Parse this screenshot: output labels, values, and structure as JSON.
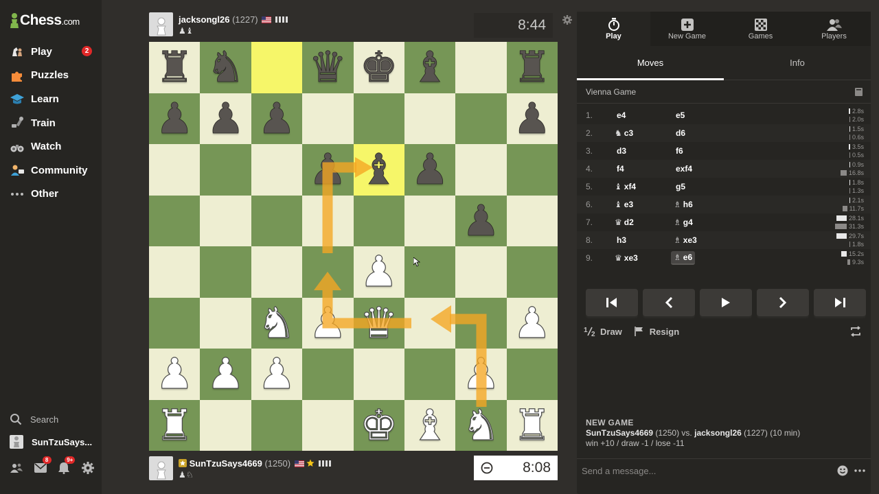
{
  "sidebar": {
    "logo_main": "Chess",
    "logo_suffix": ".com",
    "items": [
      {
        "label": "Play",
        "icon": "play-pieces-icon",
        "badge": "2"
      },
      {
        "label": "Puzzles",
        "icon": "puzzle-icon"
      },
      {
        "label": "Learn",
        "icon": "graduation-cap-icon"
      },
      {
        "label": "Train",
        "icon": "train-icon"
      },
      {
        "label": "Watch",
        "icon": "binoculars-icon"
      },
      {
        "label": "Community",
        "icon": "community-icon"
      },
      {
        "label": "Other",
        "icon": "more-dots-icon"
      }
    ],
    "search_label": "Search",
    "username": "SunTzuSays...",
    "badges": {
      "messages": "8",
      "notifications": "9+"
    }
  },
  "top_player": {
    "name": "jacksongl26",
    "rating": "(1227)",
    "captured": "♟♝",
    "clock": "8:44"
  },
  "bottom_player": {
    "name": "SunTzuSays4669",
    "rating": "(1250)",
    "captured": "♟♘",
    "clock": "8:08"
  },
  "board": [
    [
      "r",
      "n",
      "",
      "q",
      "k",
      "b",
      "",
      "r"
    ],
    [
      "p",
      "p",
      "p",
      "",
      "",
      "",
      "",
      "p"
    ],
    [
      "",
      "",
      "",
      "p",
      "b",
      "p",
      "",
      ""
    ],
    [
      "",
      "",
      "",
      "",
      "",
      "",
      "p",
      ""
    ],
    [
      "",
      "",
      "",
      "",
      "P",
      "",
      "",
      ""
    ],
    [
      "",
      "",
      "N",
      "P",
      "Q",
      "",
      "",
      "P"
    ],
    [
      "P",
      "P",
      "P",
      "",
      "",
      "",
      "P",
      ""
    ],
    [
      "R",
      "",
      "",
      "",
      "K",
      "B",
      "N",
      "R"
    ]
  ],
  "highlights": [
    [
      0,
      2
    ],
    [
      2,
      4
    ]
  ],
  "panel": {
    "tabs": [
      {
        "label": "Play",
        "icon": "timer-icon"
      },
      {
        "label": "New Game",
        "icon": "plus-icon"
      },
      {
        "label": "Games",
        "icon": "board-icon"
      },
      {
        "label": "Players",
        "icon": "players-icon"
      }
    ],
    "subtabs": [
      "Moves",
      "Info"
    ],
    "opening": "Vienna Game",
    "moves": [
      {
        "n": "1.",
        "w": "e4",
        "wf": "",
        "b": "e5",
        "bf": "",
        "wt": "2.8s",
        "bt": "2.0s",
        "wbar": 2,
        "bbar": 1
      },
      {
        "n": "2.",
        "w": "c3",
        "wf": "♞",
        "b": "d6",
        "bf": "",
        "wt": "1.5s",
        "bt": "0.6s",
        "wbar": 1,
        "bbar": 1
      },
      {
        "n": "3.",
        "w": "d3",
        "wf": "",
        "b": "f6",
        "bf": "",
        "wt": "3.5s",
        "bt": "0.5s",
        "wbar": 2,
        "bbar": 1
      },
      {
        "n": "4.",
        "w": "f4",
        "wf": "",
        "b": "exf4",
        "bf": "",
        "wt": "0.9s",
        "bt": "16.8s",
        "wbar": 1,
        "bbar": 8
      },
      {
        "n": "5.",
        "w": "xf4",
        "wf": "♝",
        "b": "g5",
        "bf": "",
        "wt": "1.8s",
        "bt": "1.3s",
        "wbar": 1,
        "bbar": 1
      },
      {
        "n": "6.",
        "w": "e3",
        "wf": "♝",
        "b": "h6",
        "bf": "♗",
        "wt": "2.1s",
        "bt": "11.7s",
        "wbar": 1,
        "bbar": 6
      },
      {
        "n": "7.",
        "w": "d2",
        "wf": "♛",
        "b": "g4",
        "bf": "♗",
        "wt": "28.1s",
        "bt": "31.3s",
        "wbar": 14,
        "bbar": 15
      },
      {
        "n": "8.",
        "w": "h3",
        "wf": "",
        "b": "xe3",
        "bf": "♗",
        "wt": "29.7s",
        "bt": "1.8s",
        "wbar": 14,
        "bbar": 1
      },
      {
        "n": "9.",
        "w": "xe3",
        "wf": "♛",
        "b": "e6",
        "bf": "♗",
        "wt": "15.2s",
        "bt": "9.3s",
        "wbar": 7,
        "bbar": 4
      }
    ],
    "draw_label": "Draw",
    "resign_label": "Resign",
    "new_game": {
      "heading": "NEW GAME",
      "white": "SunTzuSays4669",
      "white_rating": "(1250)",
      "vs": "vs.",
      "black": "jacksongl26",
      "black_rating": "(1227)",
      "mode": "(10 min)",
      "stakes": "win +10 / draw -1 / lose -11"
    },
    "message_placeholder": "Send a message..."
  }
}
